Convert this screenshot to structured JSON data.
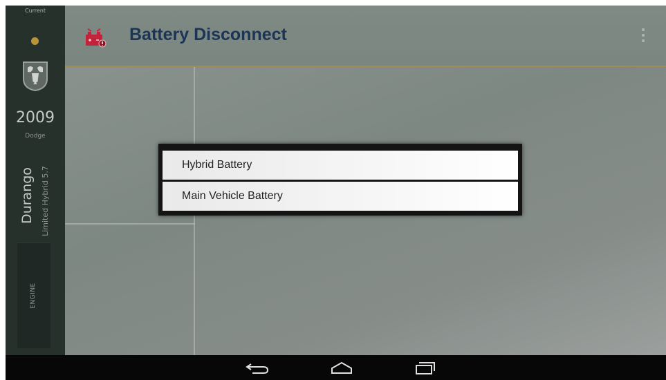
{
  "sidebar": {
    "current_label": "Current",
    "logo_icon": "ram-head-icon",
    "year": "2009",
    "make": "Dodge",
    "model": "Durango",
    "trim": "Limited Hybrid 5.7",
    "engine_label": "ENGINE",
    "status_dot_color": "#b8953a"
  },
  "header": {
    "icon": "battery-disconnect-icon",
    "title": "Battery Disconnect",
    "menu_icon": "overflow-menu-icon",
    "title_color": "#1c3555"
  },
  "dialog": {
    "options": [
      {
        "label": "Hybrid Battery"
      },
      {
        "label": "Main Vehicle Battery"
      }
    ]
  },
  "navbar": {
    "back_icon": "back-icon",
    "home_icon": "home-icon",
    "recent_icon": "recent-apps-icon"
  }
}
